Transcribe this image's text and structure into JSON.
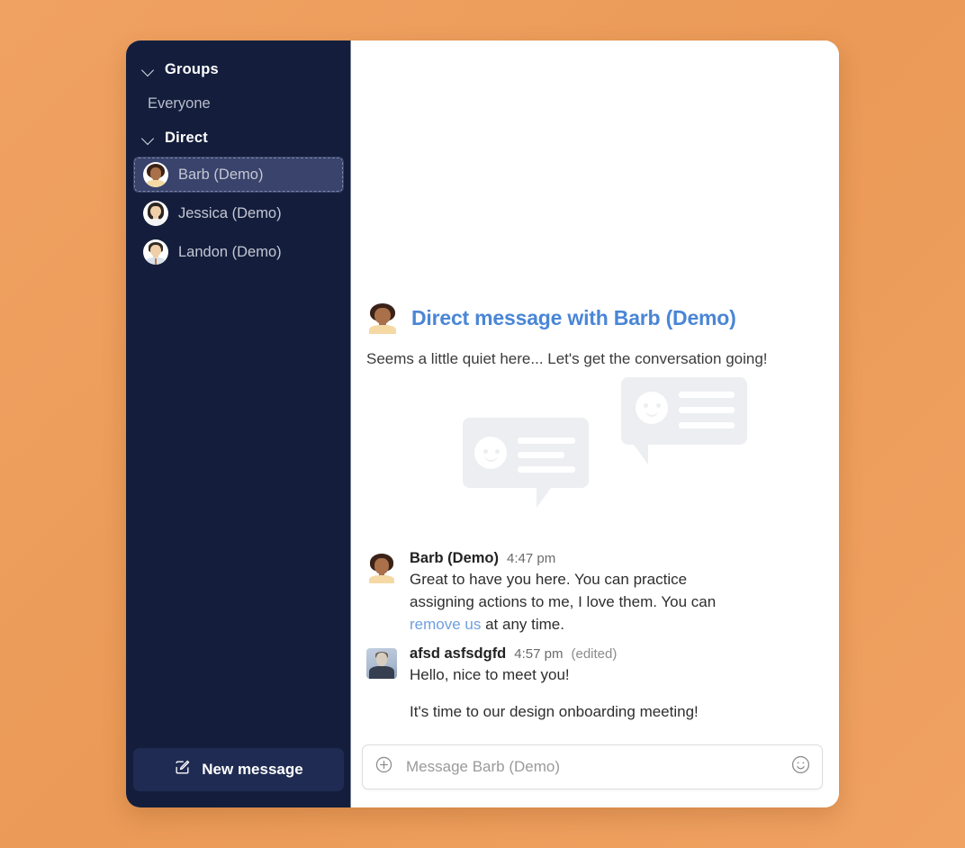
{
  "theme": {
    "page_background": "#f0a263",
    "sidebar_background": "#141e3c",
    "sidebar_selected_background": "#39436b",
    "accent_link": "#4a86d6",
    "message_link": "#6f9fe0",
    "new_message_button_background": "#1f2b52",
    "panel_background": "#ffffff",
    "bubble_gray": "#eceef1"
  },
  "sidebar": {
    "sections": [
      {
        "label": "Groups",
        "chevron_icon": "chevron-down-icon",
        "items": [
          {
            "label": "Everyone",
            "type": "plain"
          }
        ]
      },
      {
        "label": "Direct",
        "chevron_icon": "chevron-down-icon",
        "items": [
          {
            "label": "Barb (Demo)",
            "type": "dm",
            "avatar": "avatar-barb",
            "selected": true
          },
          {
            "label": "Jessica (Demo)",
            "type": "dm",
            "avatar": "avatar-jessica",
            "selected": false
          },
          {
            "label": "Landon (Demo)",
            "type": "dm",
            "avatar": "avatar-landon",
            "selected": false
          }
        ]
      }
    ],
    "new_message": {
      "label": "New message",
      "icon": "compose-pencil-square-icon"
    }
  },
  "main": {
    "empty_state": {
      "avatar": "avatar-barb",
      "title": "Direct message with Barb (Demo)",
      "subtitle": "Seems a little quiet here... Let's get the conversation going!",
      "illustration": "two-speech-bubbles-with-smileys"
    },
    "messages": [
      {
        "author": "Barb (Demo)",
        "time": "4:47 pm",
        "edited": "",
        "avatar": "avatar-barb",
        "paragraphs": [
          {
            "before": "Great to have you here. You can practice assigning actions to me, I love them. You can ",
            "link": "remove us",
            "after": " at any time."
          }
        ]
      },
      {
        "author": "afsd asfsdgfd",
        "time": "4:57 pm",
        "edited": "(edited)",
        "avatar": "avatar-photo-person",
        "paragraphs": [
          {
            "before": "Hello, nice to meet you!",
            "link": "",
            "after": ""
          },
          {
            "before": "It's time to our design onboarding meeting!",
            "link": "",
            "after": ""
          }
        ]
      }
    ],
    "composer": {
      "placeholder": "Message Barb (Demo)",
      "value": "",
      "add_icon": "plus-circle-icon",
      "emoji_icon": "smiley-face-icon"
    }
  }
}
